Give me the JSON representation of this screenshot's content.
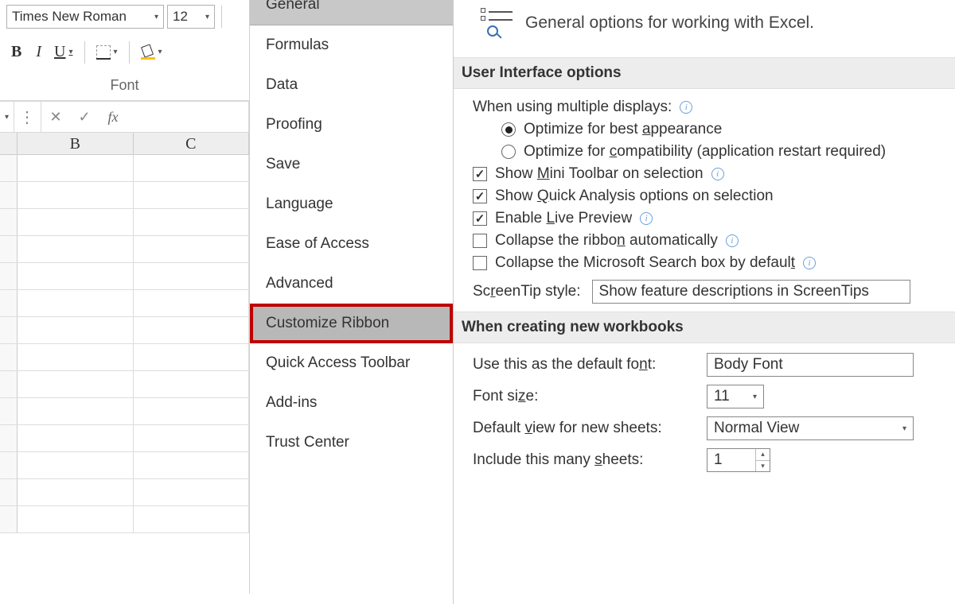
{
  "ribbon": {
    "font_name": "Times New Roman",
    "font_size": "12",
    "group_label": "Font",
    "bold": "B",
    "italic": "I",
    "underline": "U"
  },
  "formula_bar": {
    "cancel": "✕",
    "confirm": "✓",
    "fx": "fx"
  },
  "columns": [
    "B",
    "C"
  ],
  "nav": {
    "items": [
      "General",
      "Formulas",
      "Data",
      "Proofing",
      "Save",
      "Language",
      "Ease of Access",
      "Advanced",
      "Customize Ribbon",
      "Quick Access Toolbar",
      "Add-ins",
      "Trust Center"
    ]
  },
  "header": {
    "title": "General options for working with Excel."
  },
  "section1": {
    "title": "User Interface options",
    "multi_displays_label": "When using multiple displays:",
    "radio1_pre": "Optimize for best ",
    "radio1_ul": "a",
    "radio1_post": "ppearance",
    "radio2_pre": "Optimize for ",
    "radio2_ul": "c",
    "radio2_post": "ompatibility (application restart required)",
    "cb1_pre": "Show ",
    "cb1_ul": "M",
    "cb1_post": "ini Toolbar on selection",
    "cb2_pre": "Show ",
    "cb2_ul": "Q",
    "cb2_post": "uick Analysis options on selection",
    "cb3_pre": "Enable ",
    "cb3_ul": "L",
    "cb3_post": "ive Preview",
    "cb4_pre": "Collapse the ribbo",
    "cb4_ul": "n",
    "cb4_post": " automatically",
    "cb5_pre": "Collapse the Microsoft Search box by defaul",
    "cb5_ul": "t",
    "screentip_label_pre": "Sc",
    "screentip_label_ul": "r",
    "screentip_label_post": "eenTip style:",
    "screentip_value": "Show feature descriptions in ScreenTips"
  },
  "section2": {
    "title": "When creating new workbooks",
    "default_font_label_pre": "Use this as the default fo",
    "default_font_label_ul": "n",
    "default_font_label_post": "t:",
    "default_font_value": "Body Font",
    "font_size_label_pre": "Font si",
    "font_size_label_ul": "z",
    "font_size_label_post": "e:",
    "font_size_value": "11",
    "default_view_label_pre": "Default ",
    "default_view_label_ul": "v",
    "default_view_label_post": "iew for new sheets:",
    "default_view_value": "Normal View",
    "sheets_label_pre": "Include this many ",
    "sheets_label_ul": "s",
    "sheets_label_post": "heets:",
    "sheets_value": "1"
  }
}
